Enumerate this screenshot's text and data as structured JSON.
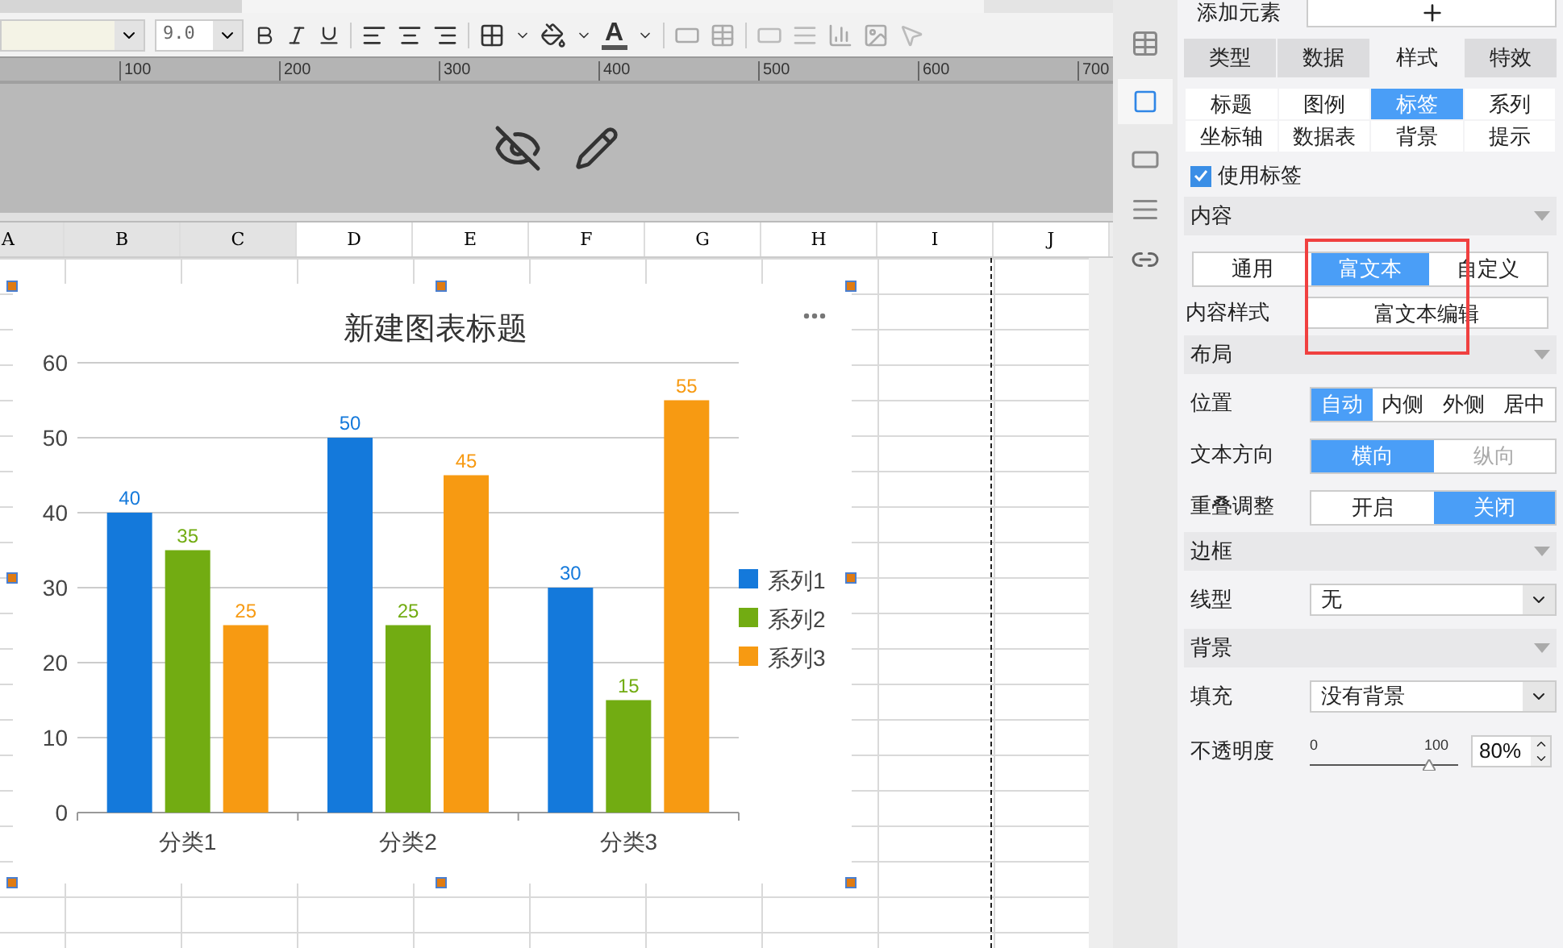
{
  "toolbar": {
    "font_size": "9.0",
    "font_color_label": "A"
  },
  "ruler": {
    "labels": [
      "100",
      "200",
      "300",
      "400",
      "500",
      "600",
      "700"
    ]
  },
  "sheet": {
    "columns": [
      {
        "label": "A",
        "selected": true
      },
      {
        "label": "B",
        "selected": true
      },
      {
        "label": "C",
        "selected": true
      },
      {
        "label": "D",
        "selected": false
      },
      {
        "label": "E",
        "selected": false
      },
      {
        "label": "F",
        "selected": false
      },
      {
        "label": "G",
        "selected": false
      },
      {
        "label": "H",
        "selected": false
      },
      {
        "label": "I",
        "selected": false
      },
      {
        "label": "J",
        "selected": false
      }
    ]
  },
  "chart": {
    "chart_data": {
      "type": "bar",
      "title": "新建图表标题",
      "grid": true,
      "legend": true,
      "categories": [
        "分类1",
        "分类2",
        "分类3"
      ],
      "series": [
        {
          "name": "系列1",
          "color": "#1479db",
          "values": [
            40,
            50,
            30
          ]
        },
        {
          "name": "系列2",
          "color": "#72ac12",
          "values": [
            35,
            25,
            15
          ]
        },
        {
          "name": "系列3",
          "color": "#f79a12",
          "values": [
            25,
            45,
            55
          ]
        }
      ],
      "ylim": [
        0,
        60
      ],
      "yticks": [
        0,
        10,
        20,
        30,
        40,
        50,
        60
      ],
      "data_labels": true
    }
  },
  "panel": {
    "add_element_label": "添加元素",
    "tabs": [
      {
        "label": "类型",
        "selected": false
      },
      {
        "label": "数据",
        "selected": false
      },
      {
        "label": "样式",
        "selected": true
      },
      {
        "label": "特效",
        "selected": false
      }
    ],
    "subtabs": [
      {
        "label": "标题",
        "selected": false
      },
      {
        "label": "图例",
        "selected": false
      },
      {
        "label": "标签",
        "selected": true
      },
      {
        "label": "系列",
        "selected": false
      },
      {
        "label": "坐标轴",
        "selected": false
      },
      {
        "label": "数据表",
        "selected": false
      },
      {
        "label": "背景",
        "selected": false
      },
      {
        "label": "提示",
        "selected": false
      }
    ],
    "use_label": {
      "label": "使用标签",
      "checked": true
    },
    "content": {
      "title": "内容",
      "options": [
        {
          "label": "通用",
          "selected": false
        },
        {
          "label": "富文本",
          "selected": true
        },
        {
          "label": "自定义",
          "selected": false
        }
      ],
      "style_label": "内容样式",
      "style_button": "富文本编辑"
    },
    "layout": {
      "title": "布局",
      "position_label": "位置",
      "position": [
        {
          "label": "自动",
          "selected": true
        },
        {
          "label": "内侧",
          "selected": false
        },
        {
          "label": "外侧",
          "selected": false
        },
        {
          "label": "居中",
          "selected": false
        }
      ],
      "direction_label": "文本方向",
      "direction": [
        {
          "label": "横向",
          "selected": true,
          "disabled": false
        },
        {
          "label": "纵向",
          "selected": false,
          "disabled": true
        }
      ],
      "overlap_label": "重叠调整",
      "overlap": [
        {
          "label": "开启",
          "selected": false
        },
        {
          "label": "关闭",
          "selected": true
        }
      ]
    },
    "border": {
      "title": "边框",
      "line_label": "线型",
      "line_value": "无"
    },
    "background": {
      "title": "背景",
      "fill_label": "填充",
      "fill_value": "没有背景",
      "opacity_label": "不透明度",
      "scale_min": "0",
      "scale_max": "100",
      "level": 0.8,
      "opacity_value": "80%"
    }
  }
}
